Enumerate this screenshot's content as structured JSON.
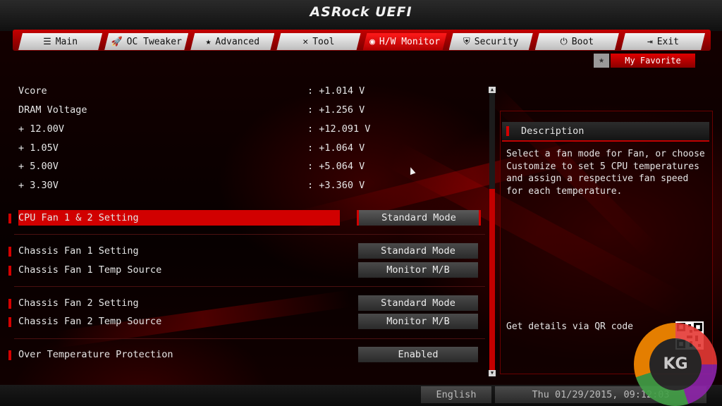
{
  "header": {
    "title": "ASRock UEFI"
  },
  "tabs": [
    {
      "label": "Main",
      "icon": "list-icon",
      "glyph": "☰"
    },
    {
      "label": "OC Tweaker",
      "icon": "rocket-icon",
      "glyph": "🚀"
    },
    {
      "label": "Advanced",
      "icon": "star-icon",
      "glyph": "★"
    },
    {
      "label": "Tool",
      "icon": "tools-icon",
      "glyph": "✕"
    },
    {
      "label": "H/W Monitor",
      "icon": "monitor-icon",
      "glyph": "◉"
    },
    {
      "label": "Security",
      "icon": "shield-icon",
      "glyph": "⛨"
    },
    {
      "label": "Boot",
      "icon": "power-icon",
      "glyph": "⏻"
    },
    {
      "label": "Exit",
      "icon": "exit-icon",
      "glyph": "⇥"
    }
  ],
  "active_tab": "H/W Monitor",
  "favorite": {
    "label": "My Favorite",
    "icon": "star-icon",
    "glyph": "★"
  },
  "voltages": [
    {
      "label": "Vcore",
      "value": ": +1.014 V"
    },
    {
      "label": "DRAM Voltage",
      "value": ": +1.256 V"
    },
    {
      "label": "+ 12.00V",
      "value": ": +12.091 V"
    },
    {
      "label": "+ 1.05V",
      "value": ": +1.064 V"
    },
    {
      "label": "+ 5.00V",
      "value": ": +5.064 V"
    },
    {
      "label": "+ 3.30V",
      "value": ": +3.360 V"
    }
  ],
  "settings": [
    {
      "label": "CPU Fan 1 & 2 Setting",
      "value": "Standard Mode",
      "selected": true
    },
    {
      "label": "Chassis Fan 1 Setting",
      "value": "Standard Mode"
    },
    {
      "label": "Chassis Fan 1 Temp Source",
      "value": "Monitor M/B"
    },
    {
      "label": "Chassis Fan 2 Setting",
      "value": "Standard Mode"
    },
    {
      "label": "Chassis Fan 2 Temp Source",
      "value": "Monitor M/B"
    },
    {
      "label": "Over Temperature Protection",
      "value": "Enabled"
    }
  ],
  "description": {
    "title": "Description",
    "body": "Select a fan mode for Fan, or choose Customize to set 5 CPU temperatures and assign a respective fan speed for each temperature.",
    "qr_text": "Get details via QR code"
  },
  "footer": {
    "language": "English",
    "datetime": "Thu 01/29/2015, 09:12:03"
  },
  "watermark": "KG",
  "colors": {
    "accent": "#d40000",
    "accent_dark": "#8c0000"
  }
}
